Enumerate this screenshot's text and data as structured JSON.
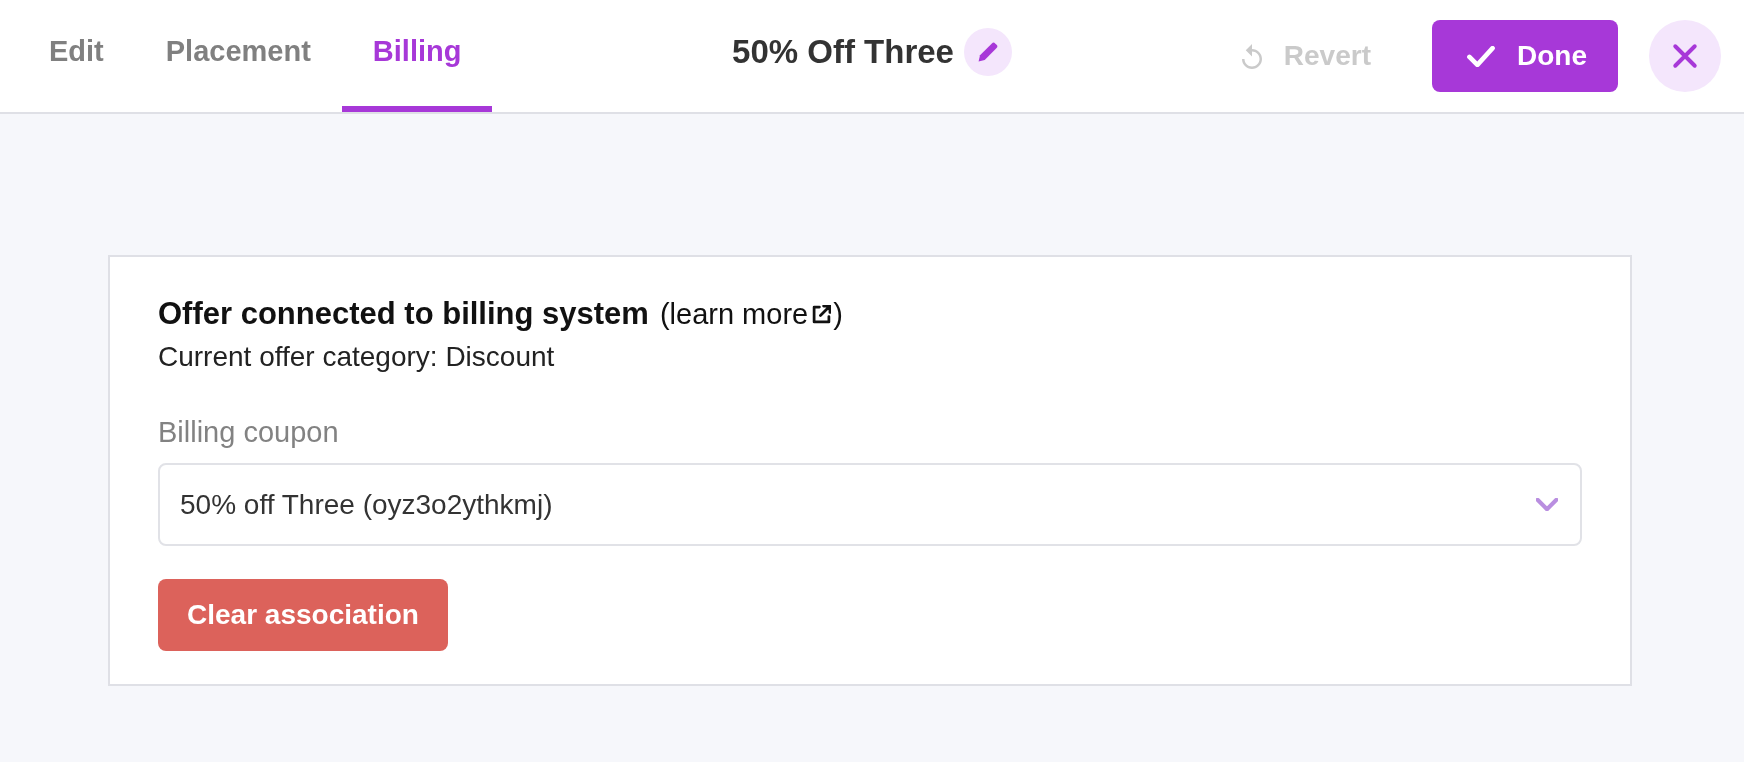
{
  "tabs": [
    {
      "label": "Edit",
      "selected": false
    },
    {
      "label": "Placement",
      "selected": false
    },
    {
      "label": "Billing",
      "selected": true
    }
  ],
  "header": {
    "title": "50% Off Three"
  },
  "actions": {
    "revert": {
      "label": "Revert",
      "disabled": true
    },
    "done": {
      "label": "Done"
    }
  },
  "billing_card": {
    "heading": "Offer connected to billing system",
    "learn_more": {
      "prefix": "(",
      "label": "learn more",
      "suffix": ")"
    },
    "category": "Current offer category: Discount",
    "coupon_field": {
      "label": "Billing coupon",
      "value": "50% off Three (oyz3o2ythkmj)"
    },
    "clear_button": {
      "label": "Clear association"
    }
  }
}
